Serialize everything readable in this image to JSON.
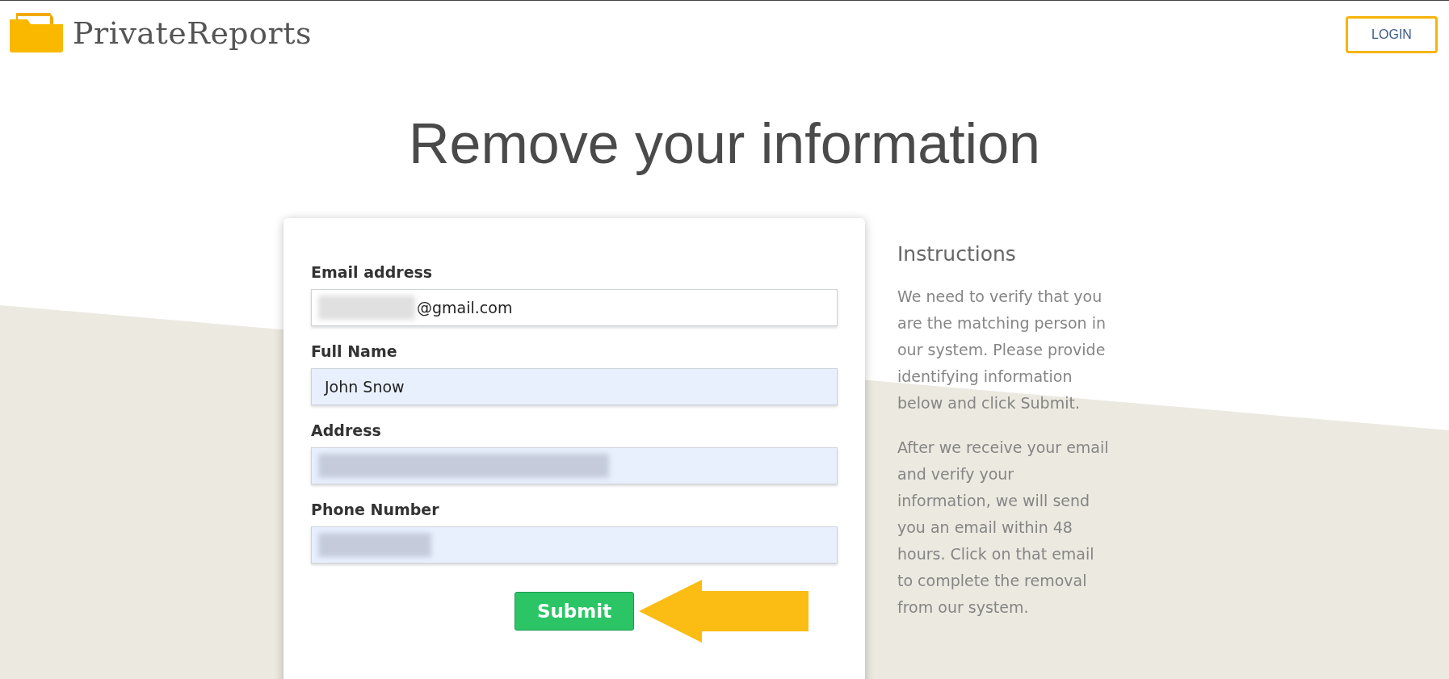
{
  "header": {
    "logo_text": "PrivateReports",
    "login_button": "LOGIN"
  },
  "title": "Remove your information",
  "form": {
    "fields": [
      {
        "label": "Email address",
        "value": "@gmail.com",
        "redacted": true,
        "autofilled": false
      },
      {
        "label": "Full Name",
        "value": "John Snow",
        "redacted": false,
        "autofilled": true
      },
      {
        "label": "Address",
        "redacted": true,
        "autofilled": true
      },
      {
        "label": "Phone Number",
        "redacted": true,
        "autofilled": true
      }
    ],
    "submit": "Submit"
  },
  "instructions": {
    "heading": "Instructions",
    "paragraphs": [
      "We need to verify that you are the matching person in our system. Please provide identifying information below and click Submit.",
      "After we receive your email and verify your information, we will send you an email within 48 hours. Click on that email to complete the removal from our system."
    ]
  }
}
